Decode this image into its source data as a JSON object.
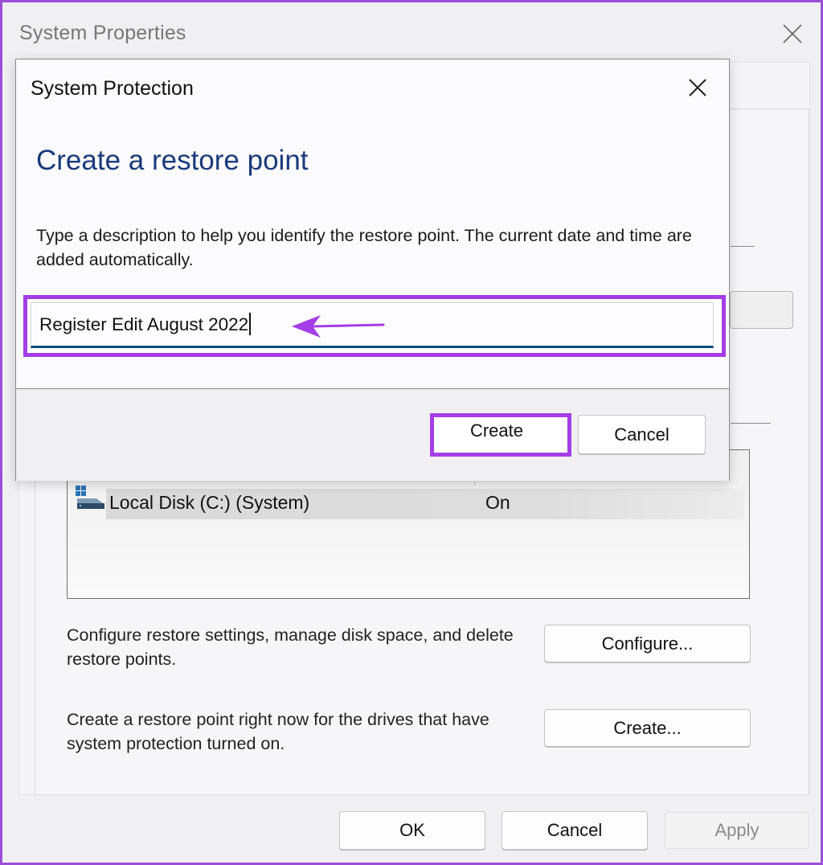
{
  "main_window": {
    "title": "System Properties",
    "close_icon": "close-icon",
    "drives": [
      {
        "name": "Local Disk (C:) (System)",
        "protection": "On",
        "icon": "system-drive-icon"
      }
    ],
    "configure_description": "Configure restore settings, manage disk space, and delete restore points.",
    "configure_button": "Configure...",
    "create_description": "Create a restore point right now for the drives that have system protection turned on.",
    "create_button": "Create...",
    "footer": {
      "ok": "OK",
      "cancel": "Cancel",
      "apply": "Apply"
    }
  },
  "dialog": {
    "title": "System Protection",
    "heading": "Create a restore point",
    "description": "Type a description to help you identify the restore point. The current date and time are added automatically.",
    "input_value": "Register Edit August 2022",
    "create_button": "Create",
    "cancel_button": "Cancel"
  },
  "annotations": {
    "highlight_color": "#a43ee6",
    "arrow_icon": "arrow-left-icon"
  }
}
